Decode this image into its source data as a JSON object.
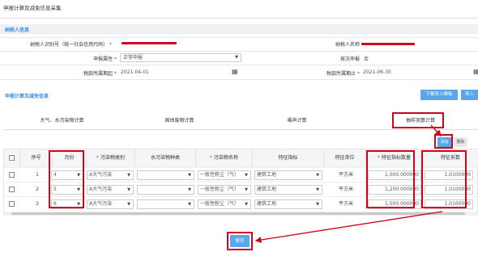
{
  "page_title": "申报计算及减免信息采集",
  "taxpayer_section": {
    "title": "纳税人信息",
    "id_label": "纳税人识别号（统一社会信用代码）",
    "name_label": "纳税人名称",
    "attr_label": "申报属性",
    "attr_value": "正常申报",
    "times_label": "按次申报",
    "times_value": "否",
    "start_label": "税款所属期起",
    "start_value": "2021-04-01",
    "end_label": "税款所属期止",
    "end_value": "2021-06-30"
  },
  "calc_section": {
    "title": "申报计算及减免信息",
    "download_btn": "下载导入模板",
    "import_btn": "导入"
  },
  "tabs": [
    "大气、水污染物计算",
    "固体废物计算",
    "噪声计算",
    "抽样测算计算"
  ],
  "toolbar": {
    "add": "添加",
    "delete": "删除"
  },
  "columns": [
    "序号",
    "月份",
    "污染物类别",
    "水污染物种类",
    "污染物名称",
    "特征指标",
    "特征单位",
    "特征指标数量",
    "特征系数"
  ],
  "rows": [
    {
      "no": "1",
      "month": "4",
      "category": "A大气污染",
      "pollutant": "一般性粉尘（气）",
      "indicator": "建筑工地",
      "unit": "平方米",
      "quantity": "1,000.000000",
      "coef": "1.0100000"
    },
    {
      "no": "2",
      "month": "5",
      "category": "A大气污染",
      "pollutant": "一般性粉尘（气）",
      "indicator": "建筑工地",
      "unit": "平方米",
      "quantity": "1,200.000000",
      "coef": "1.0100000"
    },
    {
      "no": "3",
      "month": "6",
      "category": "A大气污染",
      "pollutant": "一般性粉尘（气）",
      "indicator": "建筑工地",
      "unit": "平方米",
      "quantity": "1,500.000000",
      "coef": "1.0100000"
    }
  ],
  "save_label": "保存",
  "colors": {
    "accent": "#3a8ee6",
    "button": "#5aa6ea",
    "highlight": "#d0021b"
  }
}
